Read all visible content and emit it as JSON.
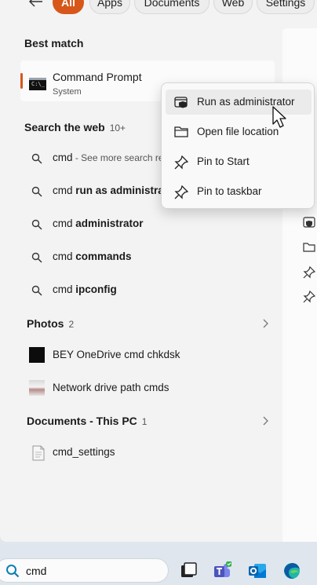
{
  "filters": {
    "back_label": "←",
    "pills": [
      {
        "label": "All",
        "active": true
      },
      {
        "label": "Apps",
        "active": false
      },
      {
        "label": "Documents",
        "active": false
      },
      {
        "label": "Web",
        "active": false
      },
      {
        "label": "Settings",
        "active": false
      }
    ]
  },
  "best_match": {
    "section_title": "Best match",
    "name": "Command Prompt",
    "type": "System",
    "icon": "cmd-icon",
    "accent_color": "#d7571a"
  },
  "web": {
    "section_title": "Search the web",
    "count": "10+",
    "results": [
      {
        "prefix": "cmd",
        "bold": "",
        "hint": " - See more search re"
      },
      {
        "prefix": "cmd ",
        "bold": "run as administra",
        "hint": ""
      },
      {
        "prefix": "cmd ",
        "bold": "administrator",
        "hint": ""
      },
      {
        "prefix": "cmd ",
        "bold": "commands",
        "hint": ""
      },
      {
        "prefix": "cmd ",
        "bold": "ipconfig",
        "hint": ""
      }
    ]
  },
  "photos": {
    "section_title": "Photos",
    "count": "2",
    "items": [
      {
        "name": "BEY OneDrive cmd chkdsk"
      },
      {
        "name": "Network drive path cmds"
      }
    ]
  },
  "documents": {
    "section_title": "Documents - This PC",
    "count": "1",
    "items": [
      {
        "name": "cmd_settings"
      }
    ]
  },
  "context_menu": {
    "items": [
      {
        "label": "Run as administrator",
        "icon": "shield-admin-icon",
        "hovered": true
      },
      {
        "label": "Open file location",
        "icon": "folder-icon",
        "hovered": false
      },
      {
        "label": "Pin to Start",
        "icon": "pin-icon",
        "hovered": false
      },
      {
        "label": "Pin to taskbar",
        "icon": "pin-icon",
        "hovered": false
      }
    ]
  },
  "taskbar": {
    "search_value": "cmd",
    "apps": [
      "task-view-icon",
      "teams-icon",
      "outlook-icon",
      "edge-icon"
    ]
  }
}
